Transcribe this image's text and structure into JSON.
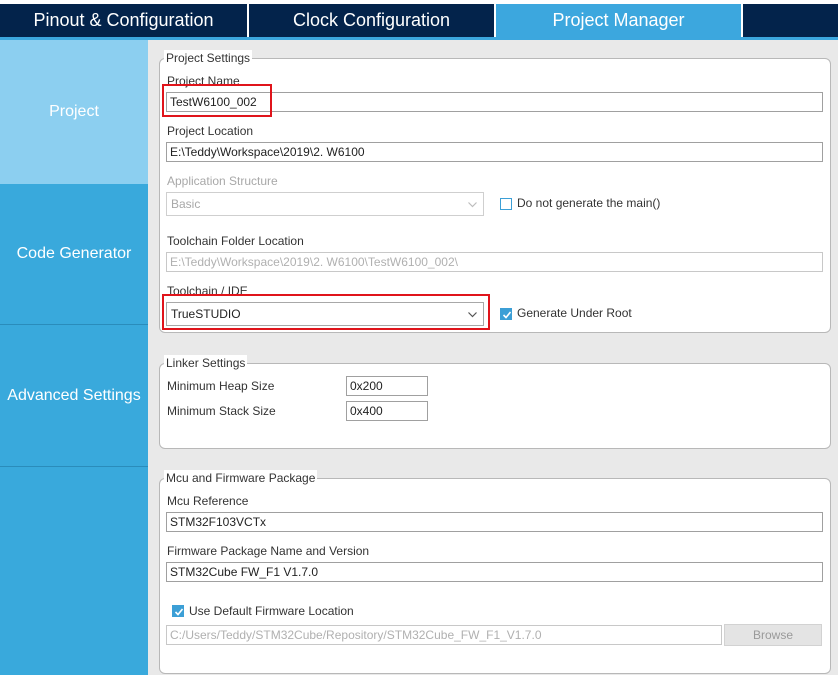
{
  "tabs": [
    {
      "label": "Pinout & Configuration",
      "active": false
    },
    {
      "label": "Clock Configuration",
      "active": false
    },
    {
      "label": "Project Manager",
      "active": true
    }
  ],
  "sidebar": {
    "items": [
      {
        "label": "Project",
        "active": true
      },
      {
        "label": "Code Generator",
        "active": false
      },
      {
        "label": "Advanced Settings",
        "active": false
      }
    ]
  },
  "project_settings": {
    "title": "Project Settings",
    "project_name_label": "Project Name",
    "project_name_value": "TestW6100_002",
    "project_location_label": "Project Location",
    "project_location_value": "E:\\Teddy\\Workspace\\2019\\2. W6100",
    "app_structure_label": "Application Structure",
    "app_structure_value": "Basic",
    "no_main_label": "Do not generate the main()",
    "no_main_checked": false,
    "toolchain_folder_label": "Toolchain Folder Location",
    "toolchain_folder_value": "E:\\Teddy\\Workspace\\2019\\2. W6100\\TestW6100_002\\",
    "toolchain_ide_label": "Toolchain / IDE",
    "toolchain_ide_value": "TrueSTUDIO",
    "generate_root_label": "Generate Under Root",
    "generate_root_checked": true
  },
  "linker_settings": {
    "title": "Linker Settings",
    "heap_label": "Minimum Heap Size",
    "heap_value": "0x200",
    "stack_label": "Minimum Stack Size",
    "stack_value": "0x400"
  },
  "mcu_firmware": {
    "title": "Mcu and Firmware Package",
    "mcu_ref_label": "Mcu Reference",
    "mcu_ref_value": "STM32F103VCTx",
    "fw_package_label": "Firmware Package Name and Version",
    "fw_package_value": "STM32Cube FW_F1 V1.7.0",
    "default_fw_label": "Use Default Firmware Location",
    "default_fw_checked": true,
    "fw_location_value": "C:/Users/Teddy/STM32Cube/Repository/STM32Cube_FW_F1_V1.7.0",
    "browse_label": "Browse"
  },
  "colors": {
    "tab_dark": "#03234b",
    "accent_blue": "#3ca7de",
    "sidebar_blue": "#39a9dc",
    "sidebar_active": "#8ccff0",
    "highlight_red": "#e0141b"
  }
}
